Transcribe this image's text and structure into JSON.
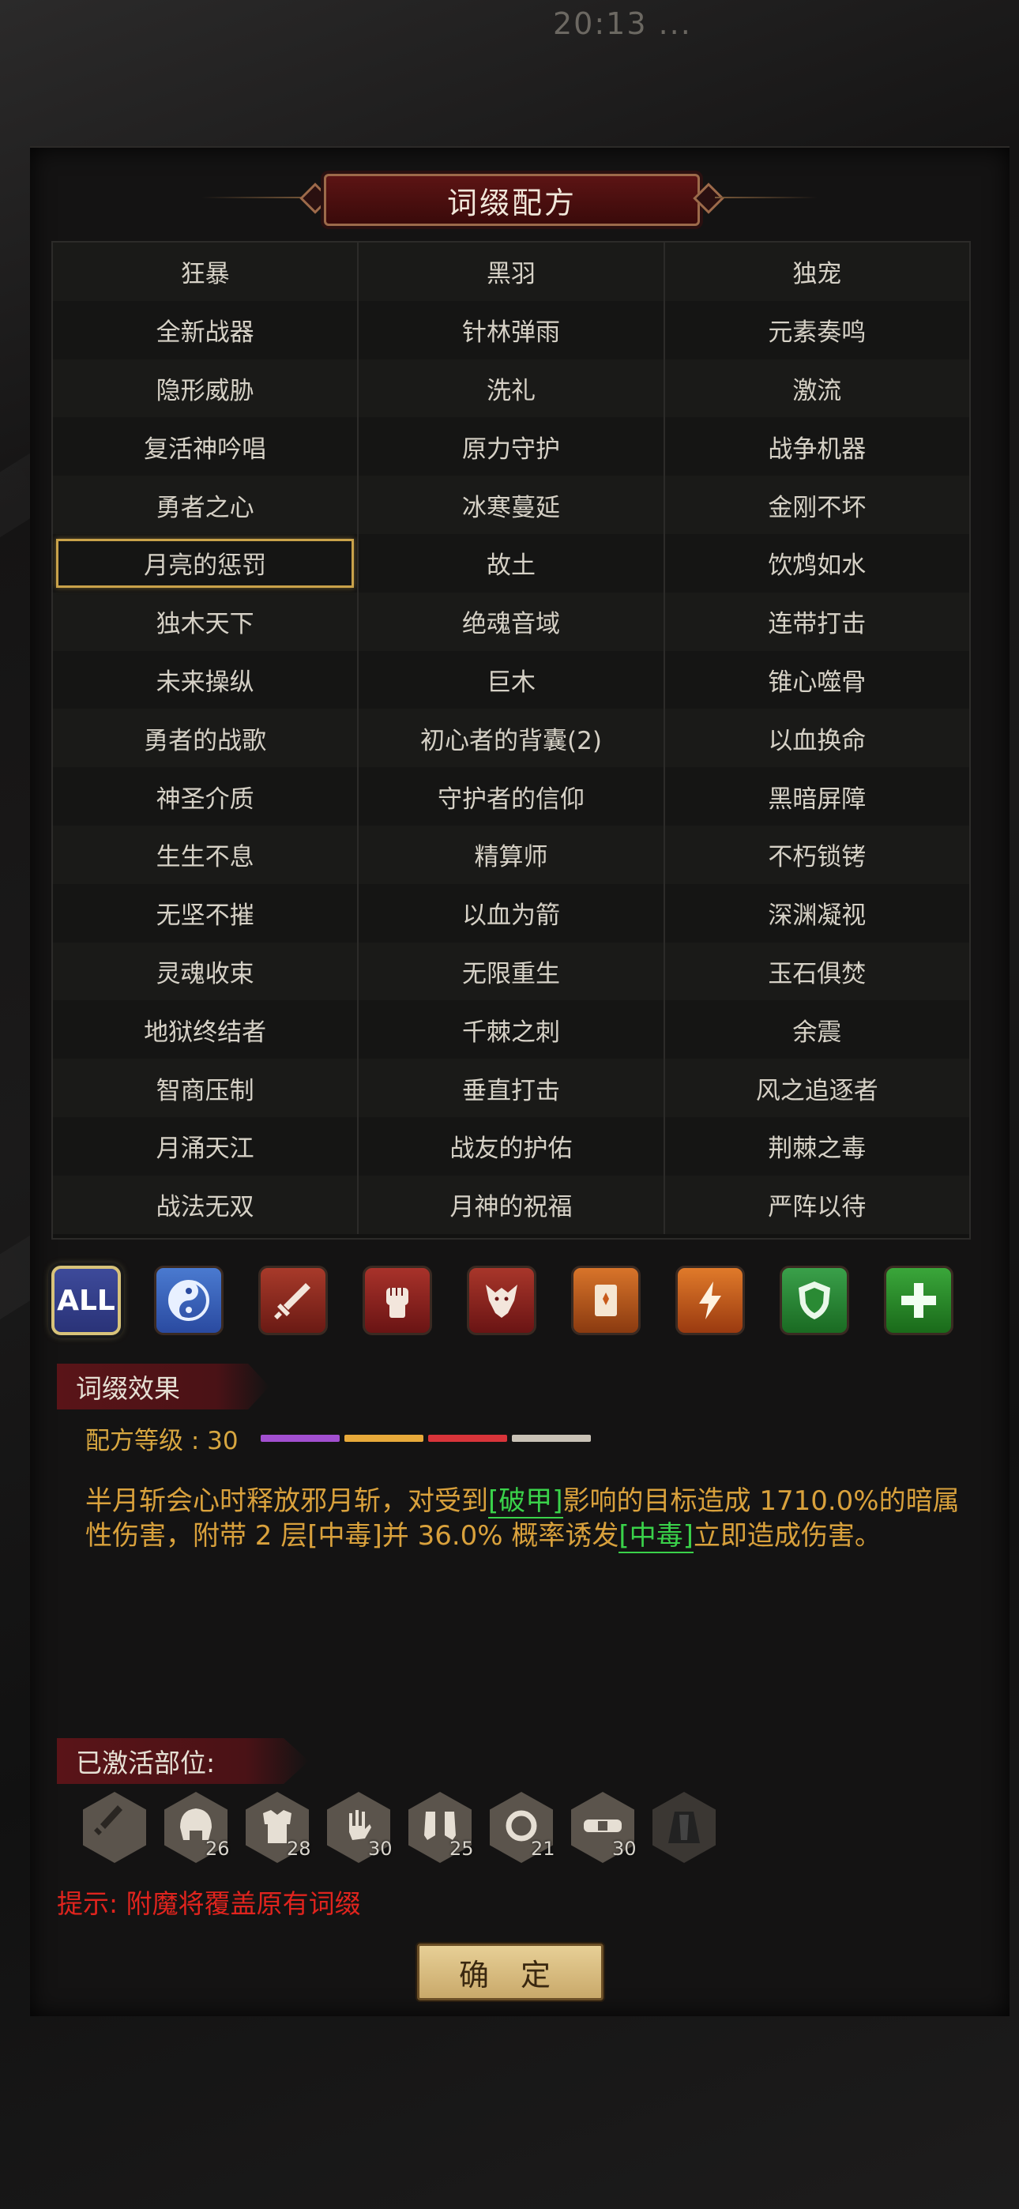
{
  "status_time": "20:13 ...",
  "title": "词缀配方",
  "affixes": [
    [
      "狂暴",
      "黑羽",
      "独宠"
    ],
    [
      "全新战器",
      "针林弹雨",
      "元素奏鸣"
    ],
    [
      "隐形威胁",
      "洗礼",
      "激流"
    ],
    [
      "复活神吟唱",
      "原力守护",
      "战争机器"
    ],
    [
      "勇者之心",
      "冰寒蔓延",
      "金刚不坏"
    ],
    [
      "月亮的惩罚",
      "故土",
      "饮鸩如水"
    ],
    [
      "独木天下",
      "绝魂音域",
      "连带打击"
    ],
    [
      "未来操纵",
      "巨木",
      "锥心噬骨"
    ],
    [
      "勇者的战歌",
      "初心者的背囊(2)",
      "以血换命"
    ],
    [
      "神圣介质",
      "守护者的信仰",
      "黑暗屏障"
    ],
    [
      "生生不息",
      "精算师",
      "不朽锁铐"
    ],
    [
      "无坚不摧",
      "以血为箭",
      "深渊凝视"
    ],
    [
      "灵魂收束",
      "无限重生",
      "玉石俱焚"
    ],
    [
      "地狱终结者",
      "千棘之刺",
      "余震"
    ],
    [
      "智商压制",
      "垂直打击",
      "风之追逐者"
    ],
    [
      "月涌天江",
      "战友的护佑",
      "荆棘之毒"
    ],
    [
      "战法无双",
      "月神的祝福",
      "严阵以待"
    ]
  ],
  "selected_affix": "月亮的惩罚",
  "filters": {
    "all_label": "ALL",
    "icons": [
      "yin-yang-icon",
      "sword-icon",
      "fist-icon",
      "wolf-icon",
      "book-icon",
      "lightning-icon",
      "shield-icon",
      "plus-icon"
    ]
  },
  "effect_section": {
    "label": "词缀效果",
    "level_label": "配方等级 : 30",
    "level_colors": [
      "#a24fd0",
      "#e7a93a",
      "#d9343a",
      "#c9c2b6"
    ],
    "text_a": "半月斩会心时释放邪月斩，对受到",
    "tag_a": "[破甲]",
    "text_b": "影响的目标造成 1710.0%的暗属性伤害，附带 2 层[中毒]并 36.0% 概率诱发",
    "tag_b": "[中毒]",
    "text_c": "立即造成伤害。"
  },
  "active_section": {
    "label": "已激活部位:",
    "slots": [
      {
        "icon": "dagger-icon",
        "level": ""
      },
      {
        "icon": "helmet-icon",
        "level": "26"
      },
      {
        "icon": "armor-icon",
        "level": "28"
      },
      {
        "icon": "glove-icon",
        "level": "30"
      },
      {
        "icon": "boots-icon",
        "level": "25"
      },
      {
        "icon": "ring-icon",
        "level": "21"
      },
      {
        "icon": "belt-icon",
        "level": "30"
      },
      {
        "icon": "cloak-icon",
        "level": ""
      }
    ]
  },
  "hint": "提示: 附魔将覆盖原有词缀",
  "confirm_label": "确 定"
}
